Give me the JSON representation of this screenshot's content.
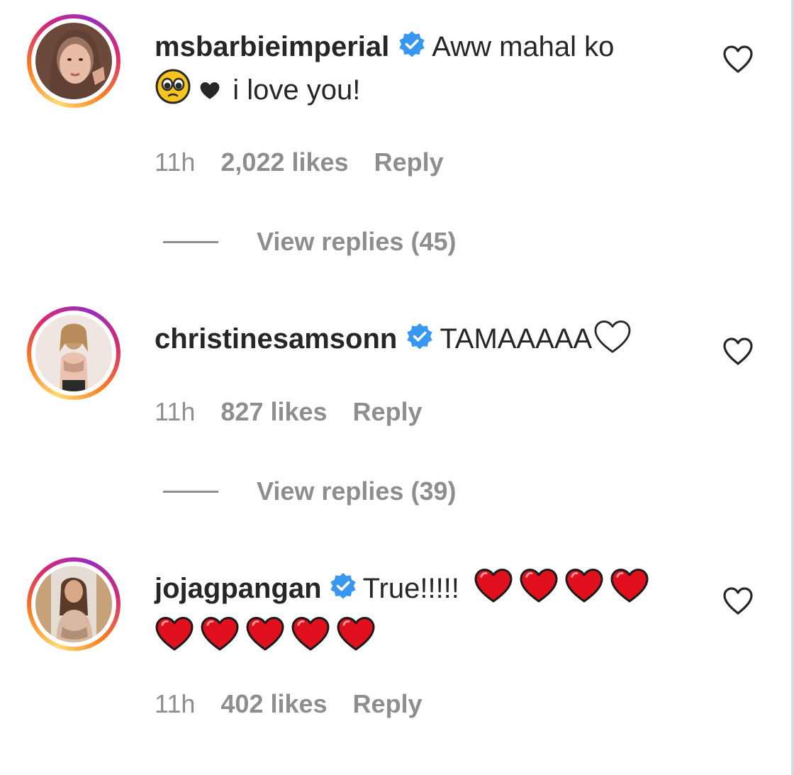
{
  "comments": [
    {
      "username": "msbarbieimperial",
      "text_line1": "Aww mahal ko",
      "text_line2": "i love you!",
      "time": "11h",
      "likes": "2,022 likes",
      "reply": "Reply",
      "view_replies": "View replies (45)",
      "emojis": [
        "pleading-face-emoji",
        "black-heart-emoji"
      ]
    },
    {
      "username": "christinesamsonn",
      "text_line1": "TAMAAAAA",
      "time": "11h",
      "likes": "827 likes",
      "reply": "Reply",
      "view_replies": "View replies (39)",
      "emojis": [
        "white-heart-emoji"
      ]
    },
    {
      "username": "jojagpangan",
      "text_line1": "True!!!!!",
      "time": "11h",
      "likes": "402 likes",
      "reply": "Reply",
      "emojis": [
        "red-heart-emoji",
        "red-heart-emoji",
        "red-heart-emoji",
        "red-heart-emoji",
        "red-heart-emoji",
        "red-heart-emoji",
        "red-heart-emoji",
        "red-heart-emoji",
        "red-heart-emoji"
      ]
    }
  ],
  "colors": {
    "text": "#262626",
    "secondary": "#8e8e8e",
    "verified_blue": "#3897f0",
    "heart_red": "#e0101e"
  },
  "icons": {
    "verified": "verified-badge-icon",
    "like": "heart-outline-icon"
  }
}
